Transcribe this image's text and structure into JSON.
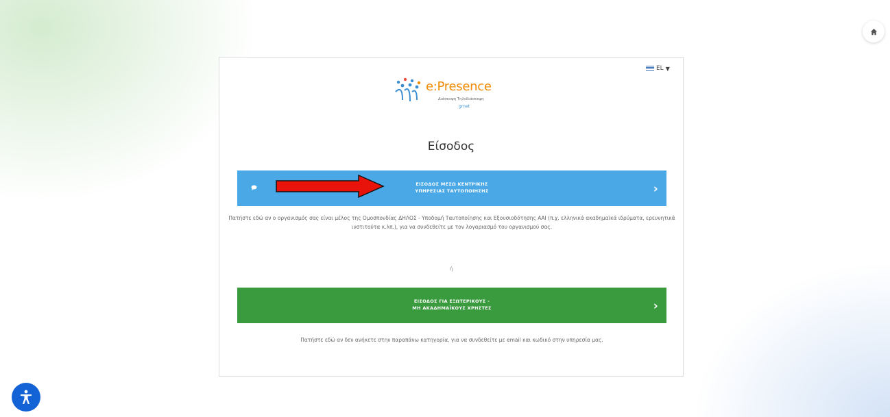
{
  "header": {
    "home_icon": "home-icon"
  },
  "language": {
    "selected": "EL",
    "flag_icon": "greek-flag-icon",
    "caret_icon": "caret-down-icon"
  },
  "logo": {
    "title": "e:Presence",
    "subtitle": "Διάσκεψη Τηλεδιάσκεψη",
    "brand": "grnet"
  },
  "page": {
    "title": "Είσοδος"
  },
  "central_login": {
    "line1": "ΕΙΣΟΔΟΣ ΜΕΣΩ ΚΕΝΤΡΙΚΗΣ",
    "line2": "ΥΠΗΡΕΣΙΑΣ ΤΑΥΤΟΠΟΙΗΣΗΣ",
    "icon": "chat-bubble-icon",
    "chevron_icon": "chevron-right-icon",
    "color": "#4aa8e6",
    "description": "Πατήστε εδώ αν ο οργανισμός σας είναι μέλος της Ομοσπονδίας ΔΗΛΟΣ - Υποδομή Ταυτοποίησης και Εξουσιοδότησης ΑΑΙ (π.χ. ελληνικά ακαδημαϊκά ιδρύματα, ερευνητικά ινστιτούτα κ.λπ.), για να συνδεθείτε με τον λογαριασμό του οργανισμού σας."
  },
  "separator": {
    "text": "ή"
  },
  "external_login": {
    "line1": "ΕΙΣΟΔΟΣ ΓΙΑ ΕΞΩΤΕΡΙΚΟΥΣ -",
    "line2": "ΜΗ ΑΚΑΔΗΜΑΪΚΟΥΣ ΧΡΗΣΤΕΣ",
    "chevron_icon": "chevron-right-icon",
    "color": "#3a9a3e",
    "description": "Πατήστε εδώ αν δεν ανήκετε στην παραπάνω κατηγορία, για να συνδεθείτε με email και κωδικό στην υπηρεσία μας."
  },
  "annotation": {
    "arrow_color": "#e8140c"
  },
  "accessibility": {
    "icon": "accessibility-icon",
    "color": "#1463d6"
  }
}
